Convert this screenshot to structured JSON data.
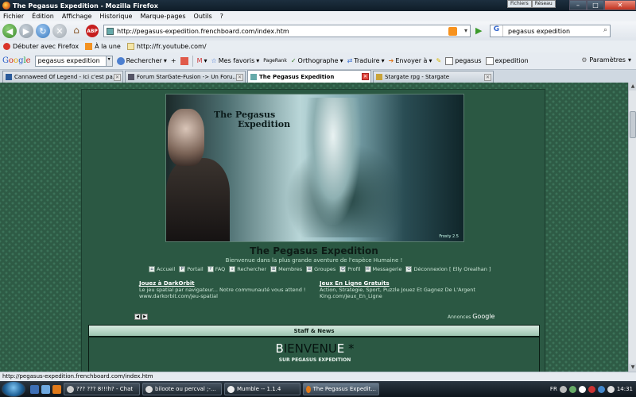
{
  "window": {
    "title": "The Pegasus Expedition - Mozilla Firefox",
    "extra_buttons": [
      "Fichiers",
      "Réseau"
    ]
  },
  "menu": [
    "Fichier",
    "Édition",
    "Affichage",
    "Historique",
    "Marque-pages",
    "Outils",
    "?"
  ],
  "nav": {
    "url": "http://pegasus-expedition.frenchboard.com/index.htm",
    "search_value": "pegasus expedition"
  },
  "bookmarks": [
    "Débuter avec Firefox",
    "À la une",
    "http://fr.youtube.com/"
  ],
  "google_toolbar": {
    "logo": [
      "G",
      "o",
      "o",
      "g",
      "l",
      "e"
    ],
    "search_value": "pegasus expedition",
    "items": [
      "Rechercher",
      "Mes favoris",
      "PageRank",
      "Orthographe",
      "Traduire",
      "Envoyer à",
      "pegasus",
      "expedition"
    ],
    "params": "Paramètres"
  },
  "tabs": [
    {
      "label": "Cannaweed Of Legend - Ici c'est pa...",
      "active": false
    },
    {
      "label": "Forum StarGate-Fusion -> Un Foru...",
      "active": false
    },
    {
      "label": "The Pegasus Expedition",
      "active": true
    },
    {
      "label": "Stargate rpg - Stargate",
      "active": false
    }
  ],
  "forum": {
    "banner_logo_l1": "The Pegasus",
    "banner_logo_l2": "Expedition",
    "banner_sig": "Frosty 2.5",
    "title": "The Pegasus Expedition",
    "description": "Bienvenue dans la plus grande aventure de l'espèce Humaine !",
    "nav": [
      "Accueil",
      "Portail",
      "FAQ",
      "Rechercher",
      "Membres",
      "Groupes",
      "Profil",
      "Messagerie",
      "Déconnexion [ Elly Orealhan ]"
    ],
    "ad1": {
      "title": "Jouez à DarkOrbit",
      "text": "Le jeu spatial par navigateur... Notre communauté vous attend !",
      "url": "www.darkorbit.com/jeu-spatial"
    },
    "ad2": {
      "title": "Jeux En Ligne Gratuits",
      "text": "Action, Strategie, Sport, Puzzle Jouez Et Gagnez De L'Argent",
      "url": "King.com/Jeux_En_Ligne"
    },
    "ads_label": "Annonces",
    "ads_brand": "Google",
    "staff_header": "Staff & News",
    "welcome_B": "B",
    "welcome_mid": "IENVENU",
    "welcome_E": "E",
    "welcome_star": " *",
    "welcome_sub": "SUR PEGASUS EXPEDITION"
  },
  "status": "http://pegasus-expedition.frenchboard.com/index.htm",
  "taskbar": {
    "tasks": [
      {
        "label": "??? ??? 8!!!h? - Chat",
        "active": false
      },
      {
        "label": "biloote ou percval ;-...",
        "active": false
      },
      {
        "label": "Mumble -- 1.1.4",
        "active": false
      },
      {
        "label": "The Pegasus Expedit...",
        "active": true
      }
    ],
    "lang": "FR",
    "clock": "14:31"
  },
  "colors": {
    "forum_bg": "#2b5843",
    "header_grad": "#9cc5b0"
  }
}
